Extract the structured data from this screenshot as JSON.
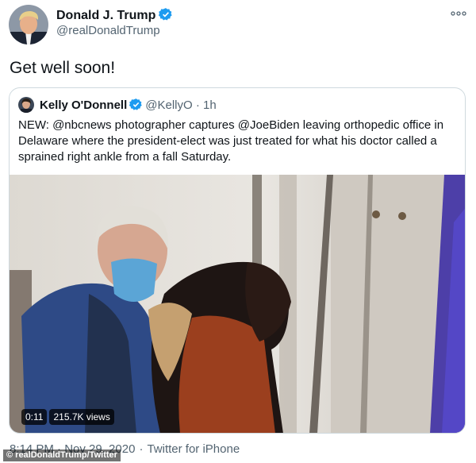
{
  "tweet": {
    "author_name": "Donald J. Trump",
    "author_handle": "@realDonaldTrump",
    "text": "Get well soon!",
    "timestamp": "8:14 PM · Nov 29, 2020",
    "source": "Twitter for iPhone",
    "icons": {
      "verified": "verified-badge-icon",
      "more": "more-options-icon"
    },
    "colors": {
      "verified": "#1d9bf0",
      "secondary_text": "#536471"
    }
  },
  "quoted_tweet": {
    "author_name": "Kelly O'Donnell",
    "author_handle": "@KellyO",
    "time_ago": "1h",
    "text_prefix": "NEW:  ",
    "mention_1": "@nbcnews",
    "text_mid": " photographer captures ",
    "mention_2": "@JoeBiden",
    "text_suffix": " leaving orthopedic office in Delaware where the president-elect was just treated for what his doctor called a sprained right ankle from a fall Saturday.",
    "video": {
      "duration": "0:11",
      "views": "215.7K views"
    }
  },
  "watermark": "© realDonaldTrump/Twitter"
}
